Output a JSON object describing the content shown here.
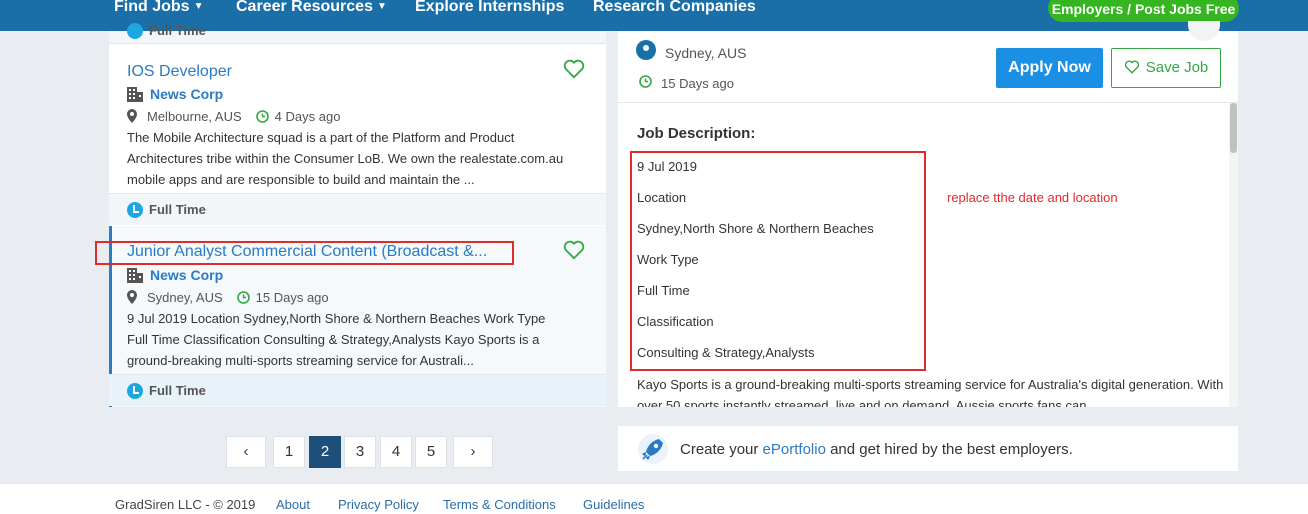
{
  "nav": {
    "items": [
      "Find Jobs",
      "Career Resources",
      "Explore Internships",
      "Research Companies"
    ],
    "employers_button": "Employers / Post Jobs Free"
  },
  "left": {
    "stub_type": "Full Time",
    "jobs": [
      {
        "title": "IOS Developer",
        "company": "News Corp",
        "location": "Melbourne, AUS",
        "age": "4 Days ago",
        "description": [
          "The Mobile Architecture squad is a part of the Platform and Product",
          "Architectures tribe within the Consumer LoB. We own the realestate.com.au",
          "mobile apps and are responsible to build and maintain the ..."
        ],
        "type": "Full Time"
      },
      {
        "title": "Junior Analyst Commercial Content (Broadcast &...",
        "company": "News Corp",
        "location": "Sydney, AUS",
        "age": "15 Days ago",
        "description": [
          "9 Jul 2019 Location Sydney,North Shore & Northern Beaches Work Type",
          "Full Time Classification Consulting & Strategy,Analysts Kayo Sports is a",
          "ground-breaking multi-sports streaming service for Australi..."
        ],
        "type": "Full Time"
      }
    ]
  },
  "pagination": {
    "prev": "‹",
    "pages": [
      "1",
      "2",
      "3",
      "4",
      "5"
    ],
    "current": "2",
    "next": "›"
  },
  "detail": {
    "location": "Sydney, AUS",
    "age": "15 Days ago",
    "apply_label": "Apply Now",
    "save_label": "Save Job",
    "description_label": "Job Description:",
    "lines": [
      "9 Jul 2019",
      "Location",
      "Sydney,North Shore & Northern Beaches",
      "Work Type",
      "Full Time",
      "Classification",
      "Consulting & Strategy,Analysts"
    ],
    "paragraph": "Kayo Sports is a ground-breaking multi-sports streaming service for Australia's digital generation. With over 50 sports instantly streamed, live and on demand, Aussie sports fans can"
  },
  "annotation": {
    "note": "replace tthe date and location",
    "color": "#e02b2b"
  },
  "portfolio": {
    "prefix": "Create your ",
    "link": "ePortfolio",
    "suffix": " and get hired by the best employers."
  },
  "footer": {
    "copyright": "GradSiren LLC - © 2019",
    "links": [
      "About",
      "Privacy Policy",
      "Terms & Conditions",
      "Guidelines"
    ]
  },
  "colors": {
    "nav_bg": "#1a6fa8",
    "link": "#2a7bc4",
    "apply": "#1a8fe3",
    "save": "#35a845",
    "employers": "#35b51f"
  }
}
